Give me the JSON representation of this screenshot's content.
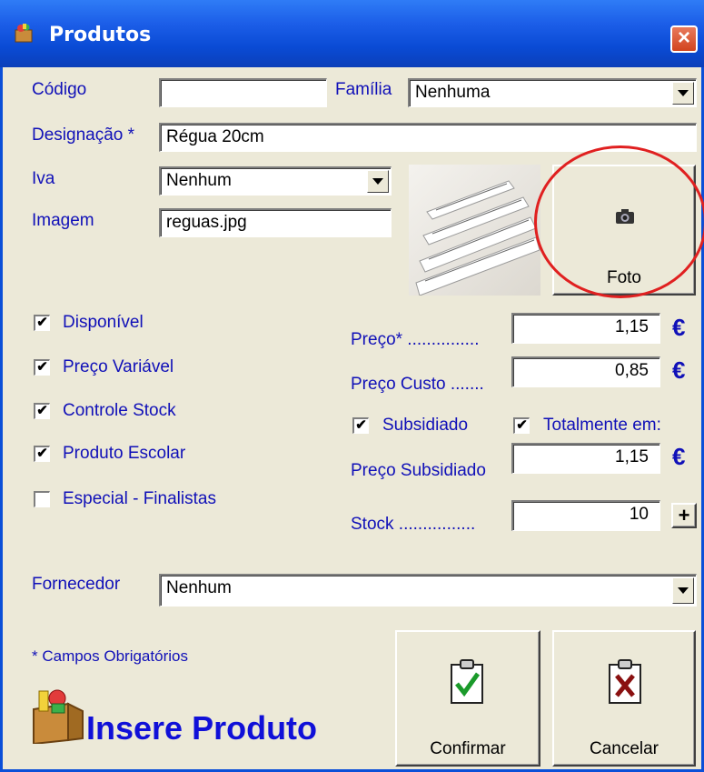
{
  "window": {
    "title": "Produtos"
  },
  "labels": {
    "codigo": "Código",
    "familia": "Família",
    "designacao": "Designação *",
    "iva": "Iva",
    "imagem": "Imagem",
    "preco": "Preço* ...............",
    "preco_custo": "Preço Custo .......",
    "preco_subsidiado": "Preço Subsidiado",
    "stock": "Stock ................",
    "fornecedor": "Fornecedor"
  },
  "fields": {
    "codigo": "",
    "familia": "Nenhuma",
    "designacao": "Régua 20cm",
    "iva": "Nenhum",
    "imagem": "reguas.jpg",
    "preco": "1,15",
    "preco_custo": "0,85",
    "preco_subsidiado": "1,15",
    "stock": "10",
    "fornecedor": "Nenhum"
  },
  "checkboxes": [
    {
      "label": "Disponível",
      "checked": true
    },
    {
      "label": "Preço Variável",
      "checked": true
    },
    {
      "label": "Controle Stock",
      "checked": true
    },
    {
      "label": "Produto Escolar",
      "checked": true
    },
    {
      "label": "Especial - Finalistas",
      "checked": false
    }
  ],
  "subsidy": {
    "subsidiado_label": "Subsidiado",
    "subsidiado_checked": true,
    "totalmente_label": "Totalmente em:",
    "totalmente_checked": true
  },
  "currency_symbol": "€",
  "buttons": {
    "foto": "Foto",
    "stock_add": "+",
    "confirmar": "Confirmar",
    "cancelar": "Cancelar"
  },
  "footer": {
    "required_note": "* Campos Obrigatórios",
    "insere_title": "Insere Produto"
  },
  "icons": {
    "app": "box-icon",
    "close": "close-icon",
    "camera": "camera-icon",
    "confirm": "clipboard-check-icon",
    "cancel": "clipboard-x-icon",
    "insere": "box-product-icon"
  },
  "colors": {
    "title_bar": "#0a4bd5",
    "label_blue": "#1010b8",
    "close_button": "#d2441d",
    "highlight_circle": "#e02020"
  }
}
